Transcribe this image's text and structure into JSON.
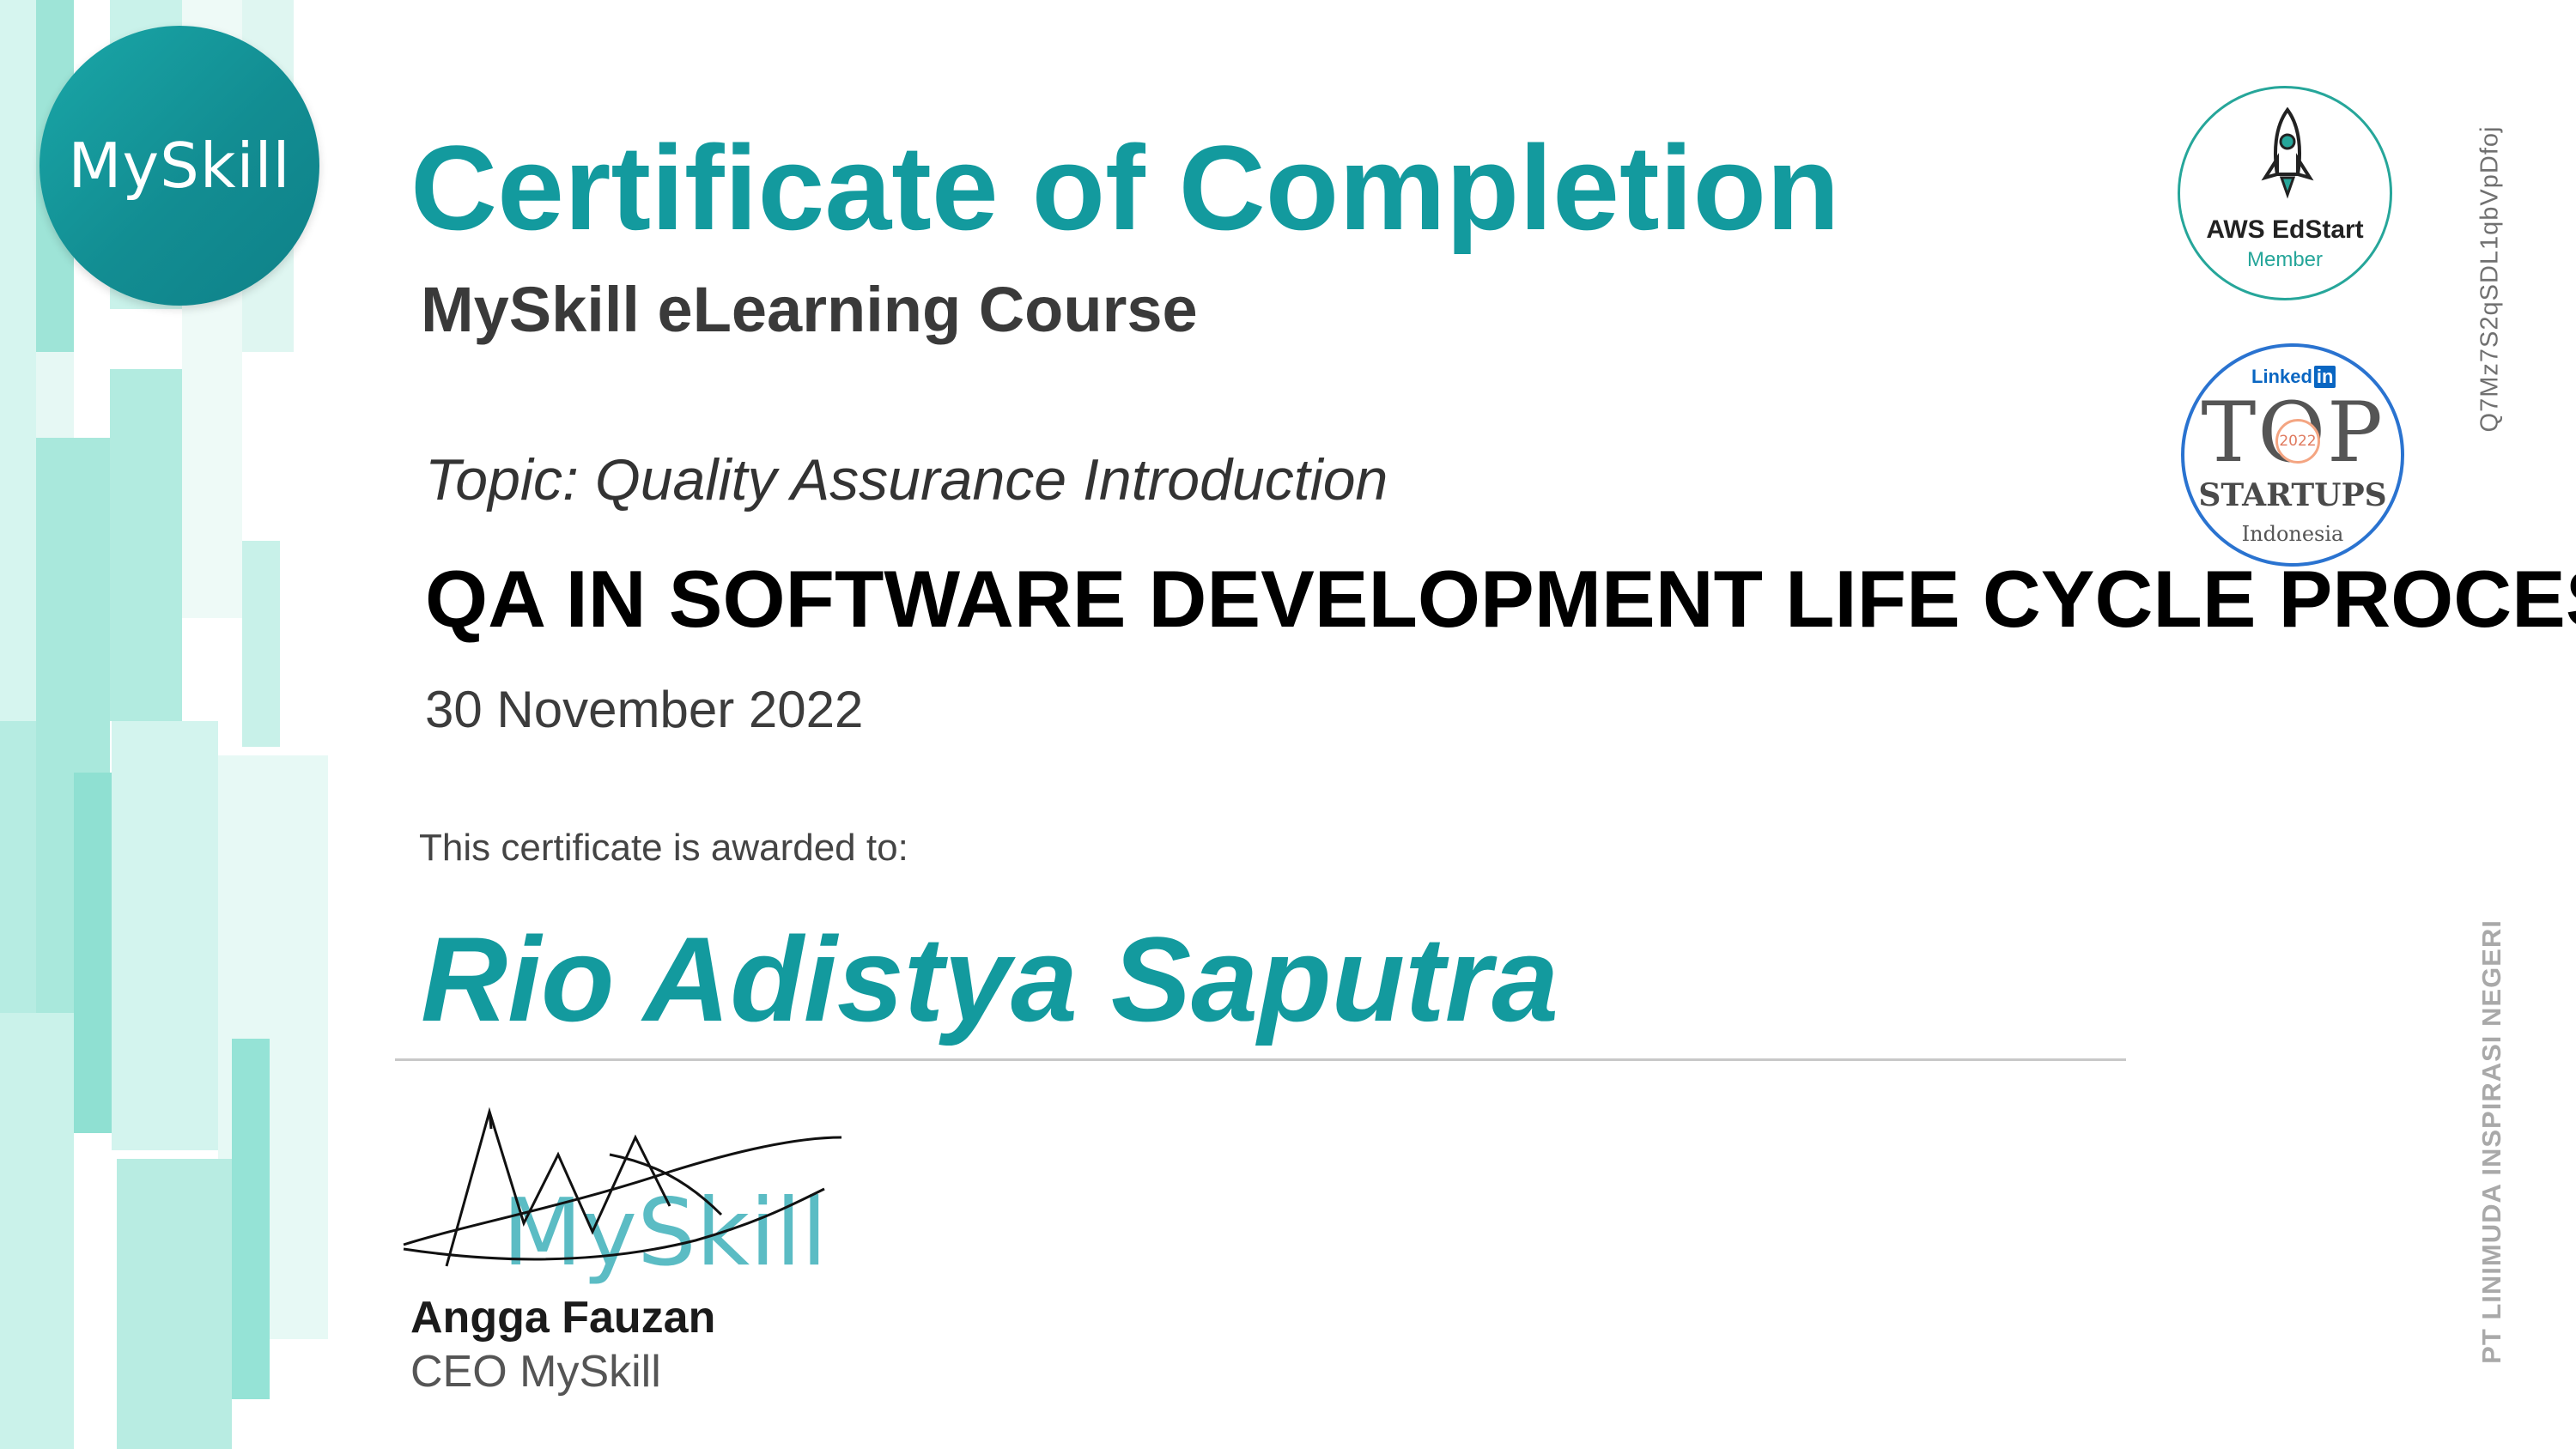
{
  "logo": {
    "text": "MySkill"
  },
  "certificate": {
    "title": "Certificate of Completion",
    "subtitle": "MySkill eLearning Course",
    "topic": "Topic: Quality Assurance Introduction",
    "course": "QA IN SOFTWARE DEVELOPMENT LIFE CYCLE PROCESS",
    "date": "30 November 2022",
    "awarded_label": "This certificate is awarded to:",
    "recipient": "Rio Adistya Saputra",
    "certificate_code": "Q7Mz7S2qSDL1qbVpDfoj",
    "company": "PT LINIMUDA INSPIRASI NEGERI"
  },
  "signatory": {
    "signature_text": "MySkill",
    "name": "Angga Fauzan",
    "title": "CEO MySkill"
  },
  "badges": {
    "aws": {
      "name": "AWS EdStart",
      "subtitle": "Member"
    },
    "linkedin": {
      "brand": "Linked",
      "brand_in": "in",
      "title": "TOP",
      "year": "2022",
      "label": "STARTUPS",
      "country": "Indonesia"
    }
  },
  "colors": {
    "accent": "#139a9e",
    "stripe_light": "#e3f7f3",
    "stripe_mid": "#b8ece3",
    "stripe_dark": "#95e3d6",
    "text": "#333333"
  }
}
